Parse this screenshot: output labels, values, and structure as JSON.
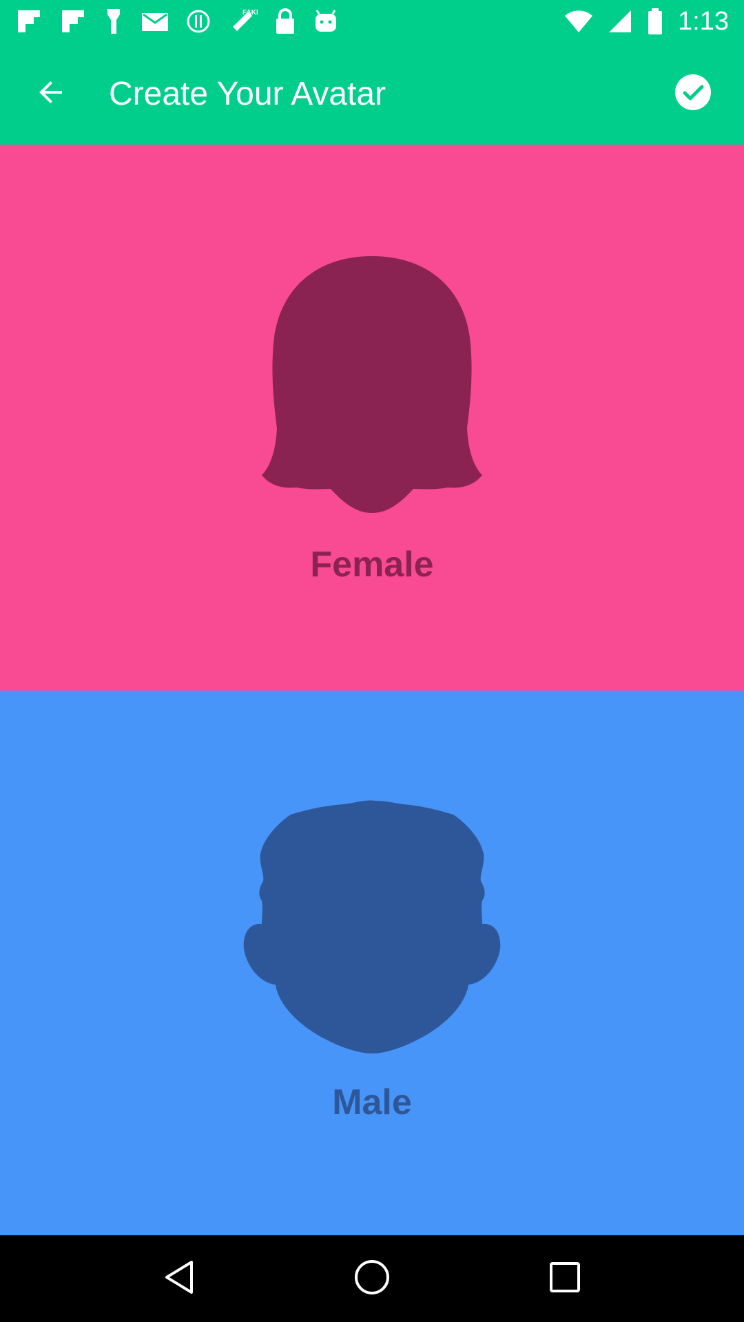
{
  "status_bar": {
    "time": "1:13",
    "left_icons": [
      "flipboard-icon",
      "flipboard-icon-2",
      "torch-icon",
      "email-icon",
      "alert-icon",
      "satellite-fake-gps-icon",
      "lock-icon",
      "android-icon"
    ],
    "right_icons": [
      "wifi-icon",
      "signal-icon",
      "battery-icon"
    ]
  },
  "app_bar": {
    "title": "Create Your Avatar",
    "back_icon": "arrow-back-icon",
    "done_icon": "check-circle-icon",
    "background": "#02ce8b"
  },
  "options": [
    {
      "label": "Female",
      "background": "#f94a94",
      "silhouette_color": "#8b2352",
      "icon": "female-head-icon"
    },
    {
      "label": "Male",
      "background": "#4895fa",
      "silhouette_color": "#2e5799",
      "icon": "male-head-icon"
    }
  ],
  "nav_bar": {
    "icons": [
      "back-triangle-icon",
      "home-circle-icon",
      "recents-square-icon"
    ]
  }
}
